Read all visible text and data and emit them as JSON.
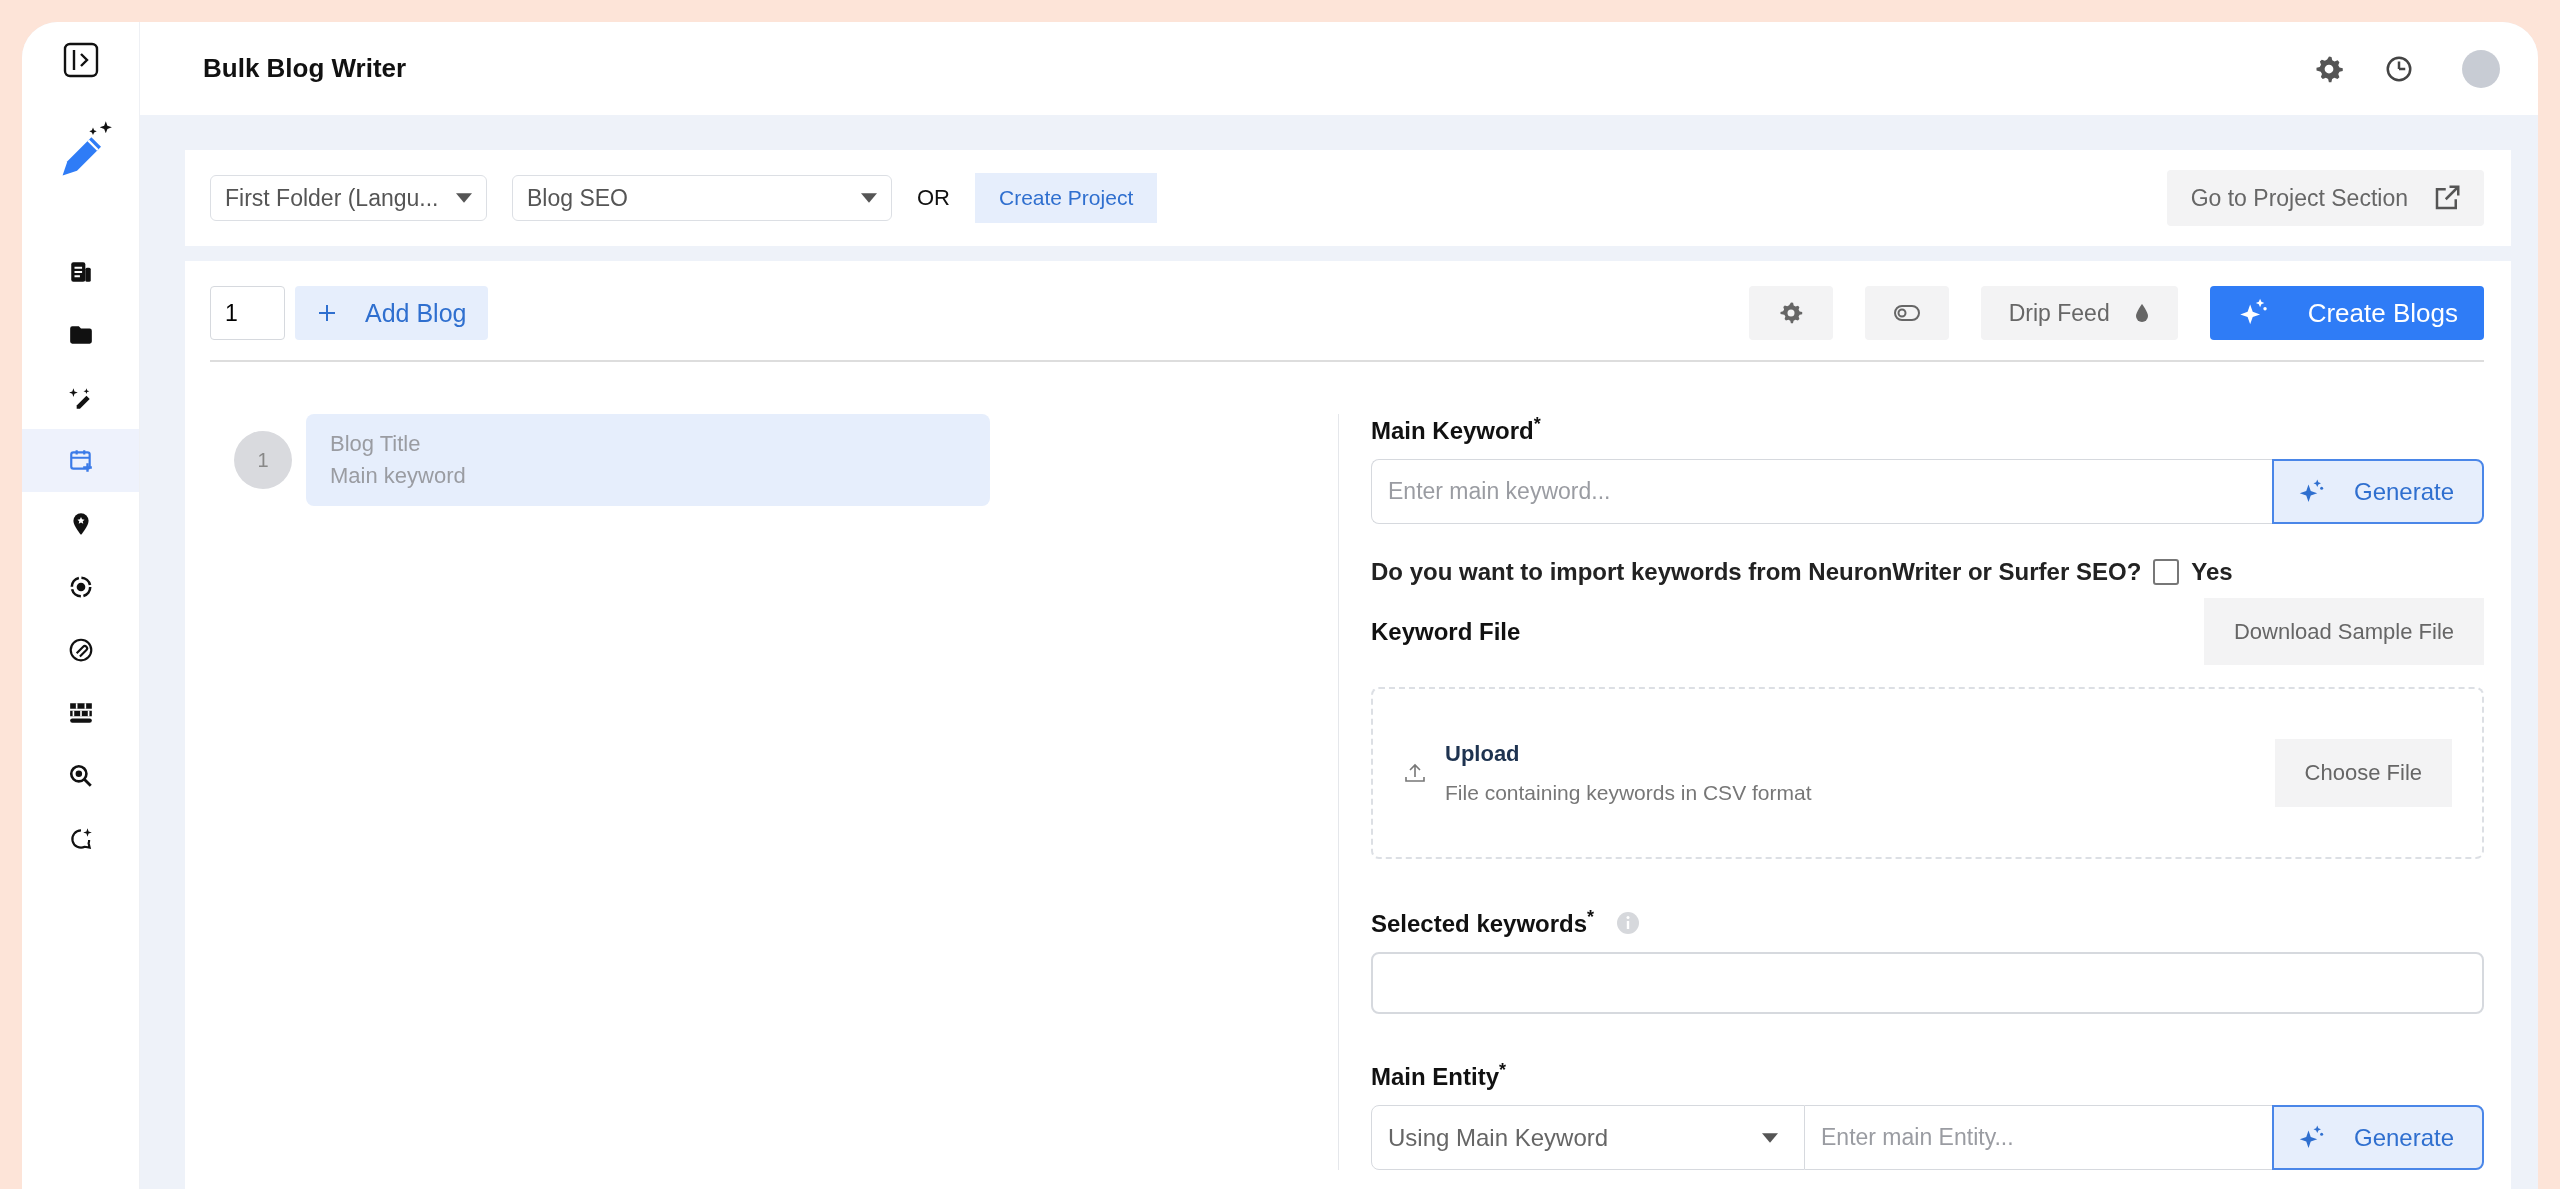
{
  "header": {
    "title": "Bulk Blog Writer"
  },
  "sidebar": {
    "items": [
      {
        "selected": false
      },
      {
        "selected": false
      },
      {
        "selected": false
      },
      {
        "selected": true
      },
      {
        "selected": false
      },
      {
        "selected": false
      },
      {
        "selected": false
      },
      {
        "selected": false
      },
      {
        "selected": false
      },
      {
        "selected": false
      }
    ]
  },
  "project_bar": {
    "folder_select": "First Folder (Langu...",
    "project_select": "Blog SEO",
    "or_label": "OR",
    "create_project": "Create Project",
    "go_to_project": "Go to Project Section"
  },
  "toolbar": {
    "blog_count": "1",
    "add_blog": "Add Blog",
    "drip_feed": "Drip Feed",
    "create_blogs": "Create Blogs"
  },
  "blogs": [
    {
      "number": "1",
      "title_placeholder": "Blog Title",
      "keyword_placeholder": "Main keyword",
      "selected": true
    }
  ],
  "form": {
    "main_keyword": {
      "label": "Main Keyword$^{*}$",
      "placeholder": "Enter main keyword...",
      "generate": "Generate"
    },
    "import_question": {
      "label": "Do you want to import keywords from NeuronWriter or Surfer SEO?",
      "checked": false,
      "option": "Yes"
    },
    "keyword_file": {
      "label": "Keyword File",
      "download": "Download Sample File",
      "upload_title": "Upload",
      "upload_hint": "File containing keywords in CSV format",
      "choose": "Choose File"
    },
    "selected_keywords": {
      "label": "Selected keywords$^{*}$"
    },
    "main_entity": {
      "label": "Main Entity$^{*}$",
      "source": "Using Main Keyword",
      "placeholder": "Enter main Entity...",
      "generate": "Generate"
    }
  }
}
